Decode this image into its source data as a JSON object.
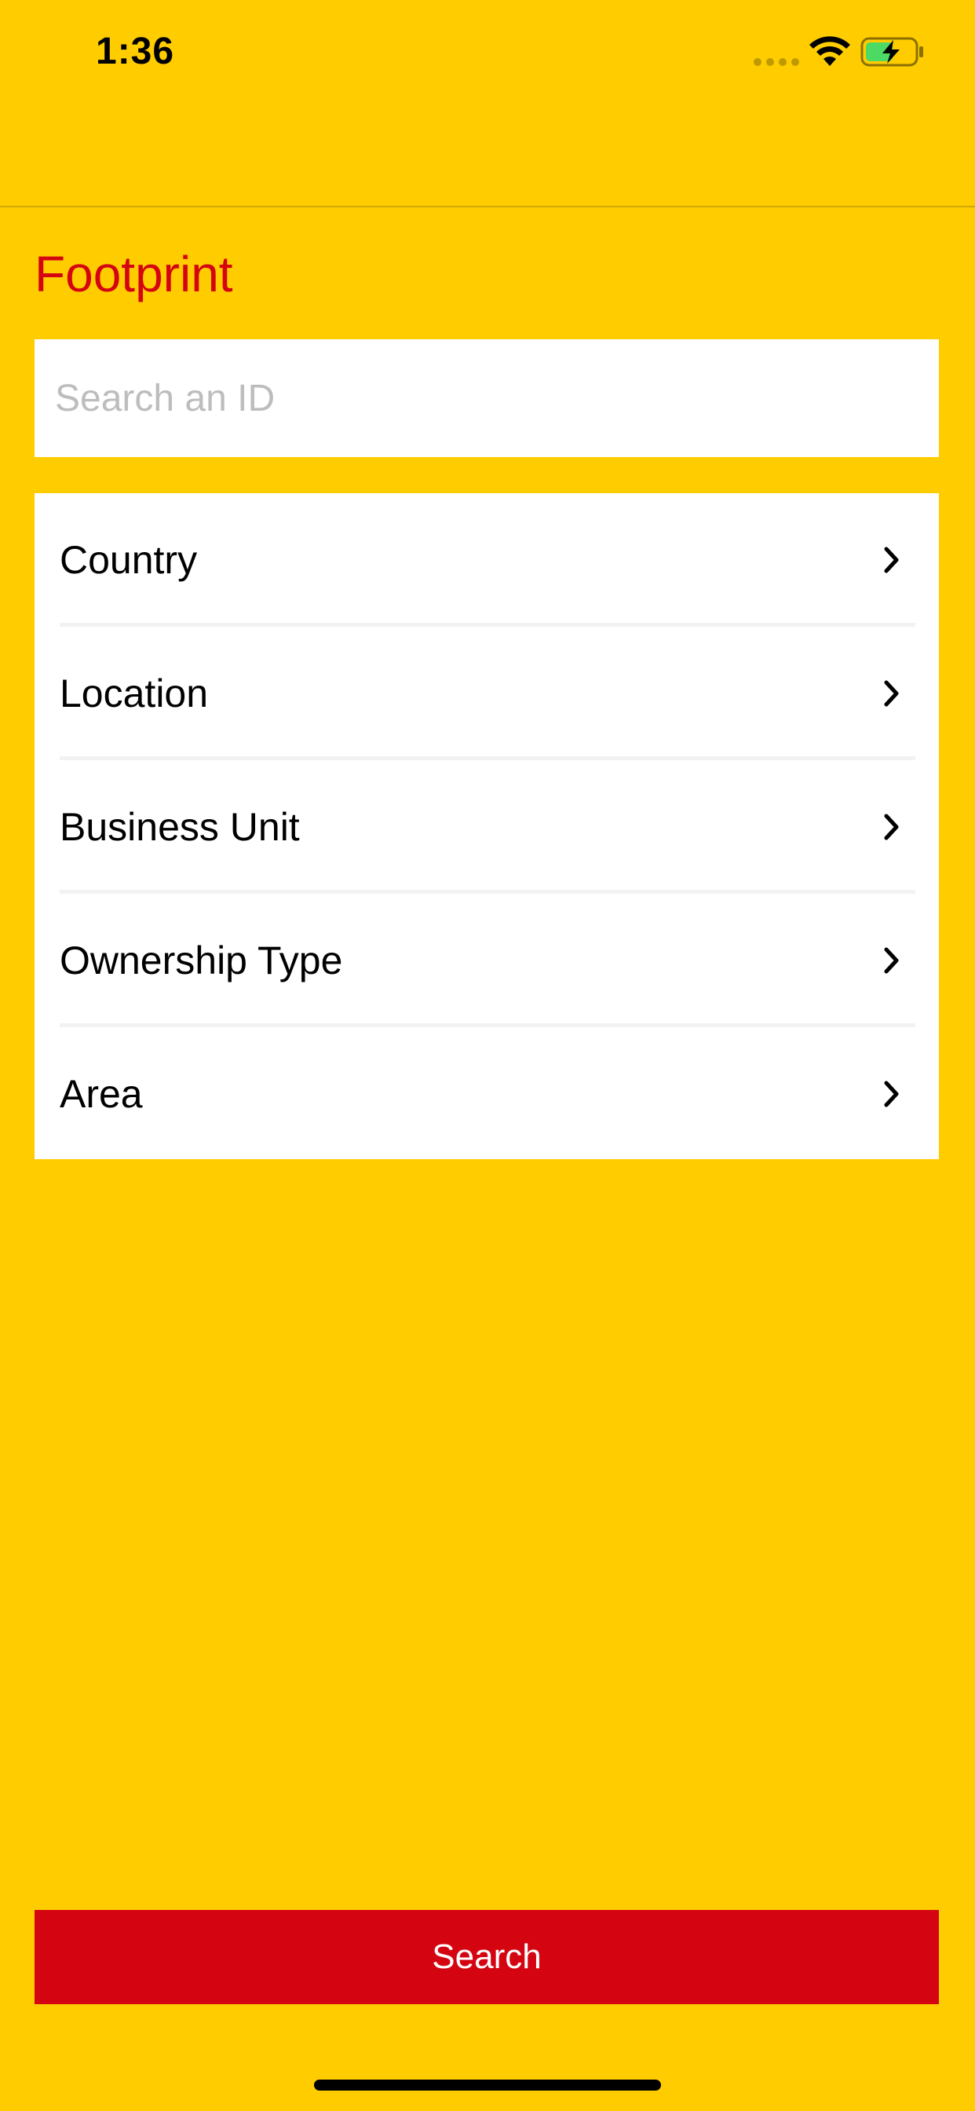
{
  "status_bar": {
    "time": "1:36",
    "icons": [
      "signal-dots-icon",
      "wifi-icon",
      "battery-charging-icon"
    ]
  },
  "header": {
    "title": "Footprint"
  },
  "search": {
    "placeholder": "Search an ID",
    "value": ""
  },
  "filters": [
    {
      "label": "Country",
      "icon": "chevron-right-icon"
    },
    {
      "label": "Location",
      "icon": "chevron-right-icon"
    },
    {
      "label": "Business Unit",
      "icon": "chevron-right-icon"
    },
    {
      "label": "Ownership Type",
      "icon": "chevron-right-icon"
    },
    {
      "label": "Area",
      "icon": "chevron-right-icon"
    }
  ],
  "actions": {
    "search_label": "Search"
  },
  "colors": {
    "background": "#FFCC00",
    "accent": "#D40511",
    "surface": "#FFFFFF",
    "placeholder": "#BDBDBD",
    "battery_fill": "#4CD964"
  }
}
